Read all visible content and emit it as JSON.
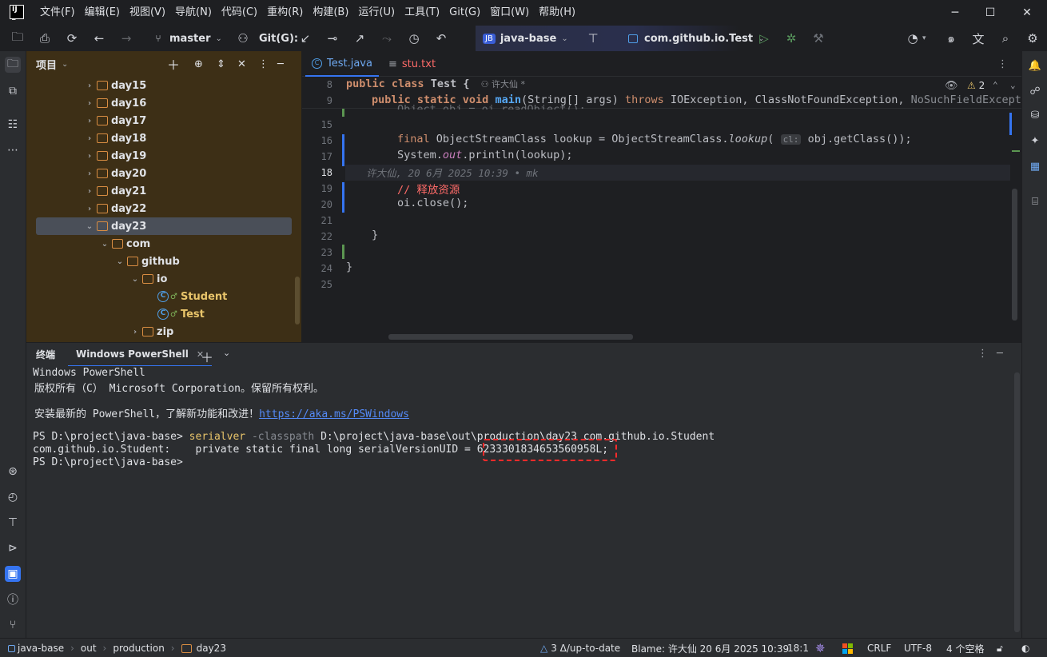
{
  "menu": [
    "文件(F)",
    "编辑(E)",
    "视图(V)",
    "导航(N)",
    "代码(C)",
    "重构(R)",
    "构建(B)",
    "运行(U)",
    "工具(T)",
    "Git(G)",
    "窗口(W)",
    "帮助(H)"
  ],
  "window_controls": {
    "minimize": "─",
    "maximize": "☐",
    "close": "✕"
  },
  "toolbar": {
    "branch": "master",
    "git_label": "Git(G):",
    "project_badge": "JB",
    "project_name": "java-base",
    "run_config": "com.github.io.Test"
  },
  "project_panel": {
    "title": "项目",
    "tree": [
      {
        "label": "day15",
        "kind": "folder",
        "indent": 0,
        "arrow": "›"
      },
      {
        "label": "day16",
        "kind": "folder",
        "indent": 0,
        "arrow": "›"
      },
      {
        "label": "day17",
        "kind": "folder",
        "indent": 0,
        "arrow": "›"
      },
      {
        "label": "day18",
        "kind": "folder",
        "indent": 0,
        "arrow": "›"
      },
      {
        "label": "day19",
        "kind": "folder",
        "indent": 0,
        "arrow": "›"
      },
      {
        "label": "day20",
        "kind": "folder",
        "indent": 0,
        "arrow": "›"
      },
      {
        "label": "day21",
        "kind": "folder",
        "indent": 0,
        "arrow": "›"
      },
      {
        "label": "day22",
        "kind": "folder",
        "indent": 0,
        "arrow": "›"
      },
      {
        "label": "day23",
        "kind": "folder",
        "indent": 0,
        "arrow": "⌄",
        "selected": true
      },
      {
        "label": "com",
        "kind": "folder",
        "indent": 1,
        "arrow": "⌄"
      },
      {
        "label": "github",
        "kind": "folder",
        "indent": 2,
        "arrow": "⌄"
      },
      {
        "label": "io",
        "kind": "folder",
        "indent": 3,
        "arrow": "⌄"
      },
      {
        "label": "Student",
        "kind": "class",
        "indent": 4,
        "arrow": ""
      },
      {
        "label": "Test",
        "kind": "class",
        "indent": 4,
        "arrow": ""
      },
      {
        "label": "zip",
        "kind": "folder",
        "indent": 3,
        "arrow": "›"
      }
    ]
  },
  "editor": {
    "tabs": [
      {
        "label": "Test.java",
        "active": true
      },
      {
        "label": "stu.txt",
        "active": false
      }
    ],
    "inspection_count": "2",
    "sticky": [
      {
        "num": "8",
        "author": "许大仙 *"
      },
      {
        "num": "9"
      }
    ],
    "line_numbers": [
      "15",
      "16",
      "17",
      "18",
      "19",
      "20",
      "21",
      "22",
      "23",
      "24",
      "25"
    ],
    "blame_line": "许大仙, 20 6月 2025 10:39 • mk",
    "hint": "cl:",
    "comment": "// 释放资源"
  },
  "terminal": {
    "tab_label": "终端",
    "active_tab": "Windows PowerShell",
    "lines": {
      "l1": "Windows PowerShell",
      "l2": "版权所有（C） Microsoft Corporation。保留所有权利。",
      "l3_prefix": "安装最新的 PowerShell，了解新功能和改进！",
      "l3_link": "https://aka.ms/PSWindows",
      "prompt": "PS D:\\project\\java-base>",
      "cmd": "serialver",
      "param": "-classpath",
      "args": "D:\\project\\java-base\\out\\production\\day23 com.github.io.Student",
      "result_prefix": "com.github.io.Student:    private static final long serialVersionUID = ",
      "result_value": "6233301834653560958L",
      "result_suffix": ";",
      "prompt2": "PS D:\\project\\java-base>"
    }
  },
  "statusbar": {
    "breadcrumbs": [
      "java-base",
      "out",
      "production",
      "day23"
    ],
    "vcs": "3 Δ/up-to-date",
    "blame": "Blame: 许大仙 20 6月 2025 10:39",
    "position": "18:1",
    "line_ending": "CRLF",
    "encoding": "UTF-8",
    "indent": "4 个空格"
  },
  "colors": {
    "accent": "#3574f0",
    "highlight_box": "#ff2b2b",
    "project_bg": "#3d2f16"
  }
}
